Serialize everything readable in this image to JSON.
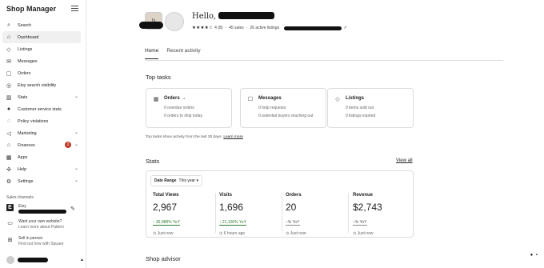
{
  "sidebar": {
    "brand": "Shop Manager",
    "items": [
      {
        "label": "Search",
        "icon": "search-icon",
        "glyph": "⌕"
      },
      {
        "label": "Dashboard",
        "icon": "home-icon",
        "glyph": "⌂",
        "active": true
      },
      {
        "label": "Listings",
        "icon": "tag-icon",
        "glyph": "◇"
      },
      {
        "label": "Messages",
        "icon": "message-icon",
        "glyph": "✉"
      },
      {
        "label": "Orders",
        "icon": "box-icon",
        "glyph": "▢"
      },
      {
        "label": "Etsy search visibility",
        "icon": "visibility-icon",
        "glyph": "◎"
      },
      {
        "label": "Stats",
        "icon": "chart-icon",
        "glyph": "▥",
        "chevron": true
      },
      {
        "label": "Customer service stats",
        "icon": "service-icon",
        "glyph": "●"
      },
      {
        "label": "Policy violations",
        "icon": "policy-icon",
        "glyph": "◌"
      },
      {
        "label": "Marketing",
        "icon": "megaphone-icon",
        "glyph": "◁",
        "chevron": true
      },
      {
        "label": "Finances",
        "icon": "bank-icon",
        "glyph": "⌂",
        "chevron": true,
        "badge": "2"
      },
      {
        "label": "Apps",
        "icon": "apps-icon",
        "glyph": "▦"
      },
      {
        "label": "Help",
        "icon": "help-icon",
        "glyph": "✣",
        "chevron": true
      },
      {
        "label": "Settings",
        "icon": "gear-icon",
        "glyph": "⚙",
        "chevron": true
      }
    ],
    "sales_channels_label": "Sales channels",
    "etsy_label": "Etsy",
    "etsy_glyph": "E",
    "pattern_line1": "Want your own website?",
    "pattern_line2": "Learn more about Pattern",
    "square_line1": "Sell in person",
    "square_line2": "Find out how with Square"
  },
  "header": {
    "greeting": "Hello,",
    "stars": "★★★★☆",
    "rating": "4 (8)",
    "sales": "45 sales",
    "active_listings": "26 active listings",
    "tabs": [
      "Home",
      "Recent activity"
    ]
  },
  "top_tasks": {
    "title": "Top tasks",
    "cards": [
      {
        "title": "Orders →",
        "icon": "orders-icon",
        "glyph": "▦",
        "lines": [
          "0 overdue orders",
          "0 orders to ship today"
        ]
      },
      {
        "title": "Messages",
        "icon": "messages-icon",
        "glyph": "☐",
        "lines": [
          "0 help requests",
          "0 potential buyers reaching out"
        ]
      },
      {
        "title": "Listings",
        "icon": "listings-icon",
        "glyph": "◇",
        "lines": [
          "0 items sold out",
          "0 listings expired"
        ]
      }
    ],
    "note": "Top tasks show activity from the last 30 days.",
    "learn_more": "Learn more"
  },
  "stats": {
    "title": "Stats",
    "view_all": "View all",
    "date_range_label": "Date Range",
    "date_range_value": "This year ▾",
    "items": [
      {
        "label": "Total Views",
        "value": "2,967",
        "delta": "↑ 36,988% YoY",
        "delta_type": "up",
        "time": "◷ Just now"
      },
      {
        "label": "Visits",
        "value": "1,696",
        "delta": "↑ 21,100% YoY",
        "delta_type": "up",
        "time": "◷ 6 hours ago"
      },
      {
        "label": "Orders",
        "value": "20",
        "delta": "–% YoY",
        "delta_type": "flat",
        "time": "◷ Just now"
      },
      {
        "label": "Revenue",
        "value": "$2,743",
        "delta": "–% YoY",
        "delta_type": "flat",
        "time": "◷ Just now"
      }
    ]
  },
  "shop_advisor": {
    "title": "Shop advisor"
  },
  "colors": {
    "accent_green": "#2e7d32",
    "badge_red": "#c0392b"
  }
}
